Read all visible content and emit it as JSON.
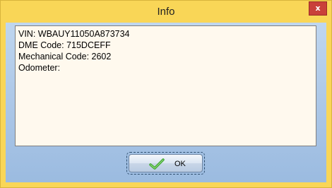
{
  "window": {
    "title": "Info",
    "close_label": "x"
  },
  "info_text": {
    "lines": [
      "VIN: WBAUY11050A873734",
      "DME Code: 715DCEFF",
      "Mechanical Code: 2602",
      "Odometer:"
    ]
  },
  "ok_button": {
    "label": "OK",
    "icon": "checkmark-icon"
  },
  "colors": {
    "titlebar": "#f9d657",
    "close_button": "#c9403a",
    "client_background": "#a9c5e6",
    "textbox_background": "#fff9ee",
    "check_icon": "#3fa72f"
  }
}
